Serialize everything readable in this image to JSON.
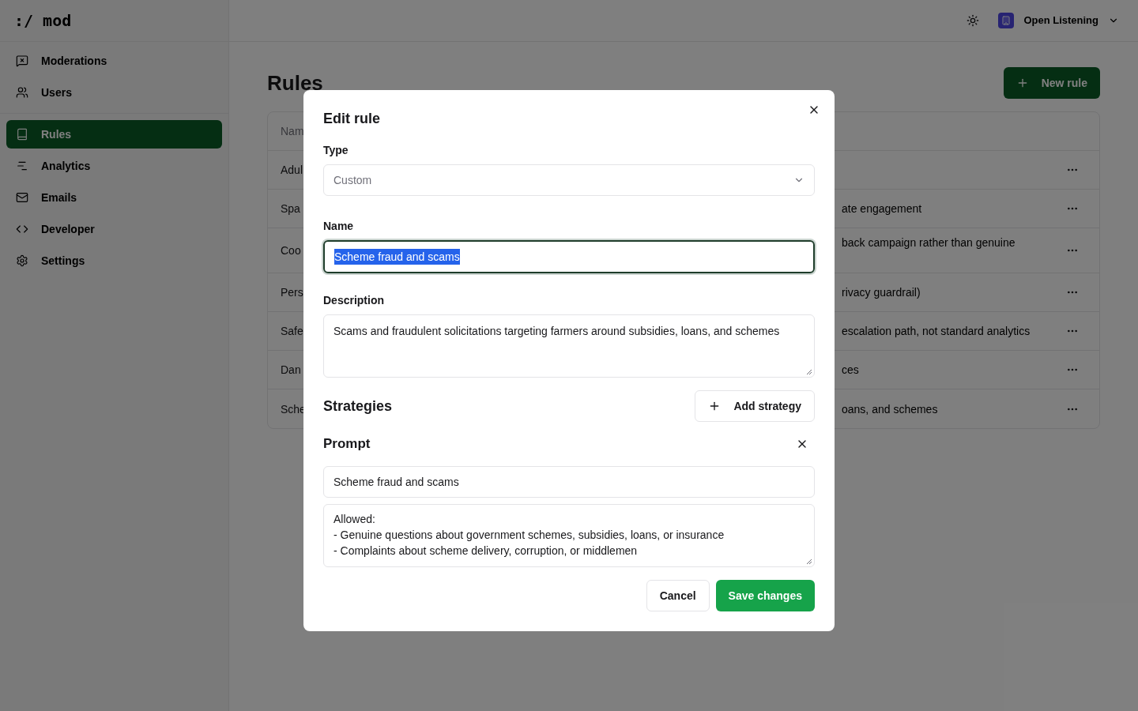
{
  "logo": ":/ mod",
  "header": {
    "workspace": "Open Listening"
  },
  "sidebar": {
    "groups": [
      [
        {
          "label": "Moderations",
          "selected": false
        },
        {
          "label": "Users",
          "selected": false
        }
      ],
      [
        {
          "label": "Rules",
          "selected": true
        },
        {
          "label": "Analytics",
          "selected": false
        },
        {
          "label": "Emails",
          "selected": false
        },
        {
          "label": "Developer",
          "selected": false
        },
        {
          "label": "Settings",
          "selected": false
        }
      ]
    ]
  },
  "page": {
    "title": "Rules",
    "new_button": "New rule"
  },
  "table": {
    "column_1": "Nam",
    "rows": [
      {
        "name": "Adul",
        "description": ""
      },
      {
        "name": "Spa",
        "description": "ate engagement"
      },
      {
        "name": "Coo",
        "description": "back campaign rather than genuine",
        "tall": true
      },
      {
        "name": "Pers",
        "description": "rivacy guardrail)"
      },
      {
        "name": "Safe",
        "description": "escalation path, not standard analytics"
      },
      {
        "name": "Dan",
        "description": "ces"
      },
      {
        "name": "Sche",
        "description": "oans, and schemes"
      }
    ]
  },
  "dialog": {
    "title": "Edit rule",
    "type_label": "Type",
    "type_value": "Custom",
    "name_label": "Name",
    "name_value": "Scheme fraud and scams",
    "name_text_selected": true,
    "description_label": "Description",
    "description_value": "Scams and fraudulent solicitations targeting farmers around subsidies, loans, and schemes",
    "strategies_title": "Strategies",
    "add_strategy": "Add strategy",
    "strategies": [
      {
        "title": "Prompt",
        "name": "Scheme fraud and scams",
        "prompt_lines": [
          "Allowed:",
          "- Genuine questions about government schemes, subsidies, loans, or insurance",
          "- Complaints about scheme delivery, corruption, or middlemen"
        ]
      }
    ],
    "buttons": [
      {
        "label": "Cancel",
        "kind": "secondary"
      },
      {
        "label": "Save changes",
        "kind": "primary"
      }
    ]
  }
}
